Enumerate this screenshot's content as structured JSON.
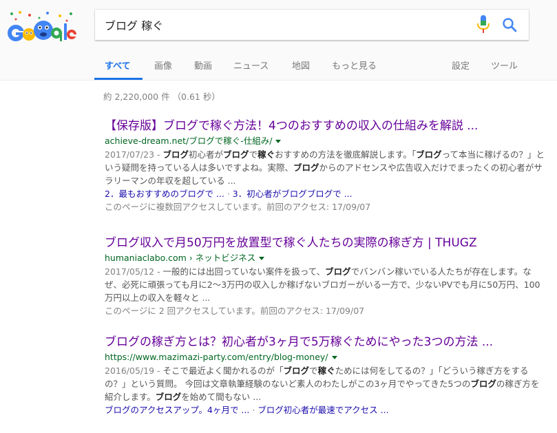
{
  "search": {
    "query": "ブログ 稼ぐ",
    "doodle_alt": "Google"
  },
  "tabs": [
    {
      "label": "すべて"
    },
    {
      "label": "画像"
    },
    {
      "label": "動画"
    },
    {
      "label": "ニュース"
    },
    {
      "label": "地図"
    },
    {
      "label": "もっと見る"
    },
    {
      "label": "設定"
    },
    {
      "label": "ツール"
    }
  ],
  "stats": "約 2,220,000 件 （0.61 秒）",
  "results": [
    {
      "title": "【保存版】ブログで稼ぐ方法！4つのおすすめの収入の仕組みを解説 ...",
      "url": "achieve-dream.net/ブログで稼ぐ-仕組み/",
      "date": "2017/07/23 - ",
      "snippet_parts": [
        "ブログ",
        "初心者が",
        "ブログ",
        "で",
        "稼ぐ",
        "おすすめの方法を徹底解説します。「",
        "ブログ",
        "って本当に稼げるの？」という疑問を持っている人は多いですよね。実際、",
        "ブログ",
        "からのアドセンスや広告収入だけでまったくの初心者がサラリーマンの年収を超している ..."
      ],
      "sublinks": [
        "2．最もおすすめのブログで ...",
        "3．初心者がブログブログで ..."
      ],
      "visits": "このページに複数回アクセスしています。前回のアクセス: 17/09/07"
    },
    {
      "title": "ブログ収入で月50万円を放置型で稼ぐ人たちの実際の稼ぎ方 | THUGZ",
      "url": "humaniaclabo.com › ネットビジネス",
      "date": "2017/05/12 - ",
      "snippet_parts": [
        "",
        "一般的には出回っていない案件を扱って、",
        "ブログ",
        "でバンバン稼いでいる人たちが存在します。なぜ、必死に頑張っても月に2〜3万円の収入しか稼げないブロガーがいる一方で、少ないPVでも月に50万円、100万円以上の収入を軽々と ..."
      ],
      "sublinks": [],
      "visits": "このページに 2 回アクセスしています。前回のアクセス: 17/09/07"
    },
    {
      "title": "ブログの稼ぎ方とは？初心者が3ヶ月で5万稼ぐためにやった3つの方法 ...",
      "url": "https://www.mazimazi-party.com/entry/blog-money/",
      "date": "2016/05/19 - ",
      "snippet_parts": [
        "",
        "そこで最近よく聞かれるのが「",
        "ブログ",
        "で",
        "稼ぐ",
        "ためには何をしてるの？」「どういう稼ぎ方をするの？」という質問。 今回は文章執筆経験のないど素人のわたしがこの3ヶ月でやってきた5つの",
        "ブログ",
        "の稼ぎ方を紹介します。",
        "ブログ",
        "を始めて間もない ..."
      ],
      "sublinks": [
        "ブログのアクセスアップ。4ヶ月で ...",
        "ブログ初心者が最速でアクセス ..."
      ],
      "visits": ""
    }
  ],
  "colors": {
    "accent": "#1a73e8",
    "visited_title": "#660099",
    "url_green": "#006621",
    "link_blue": "#1a0dab"
  }
}
